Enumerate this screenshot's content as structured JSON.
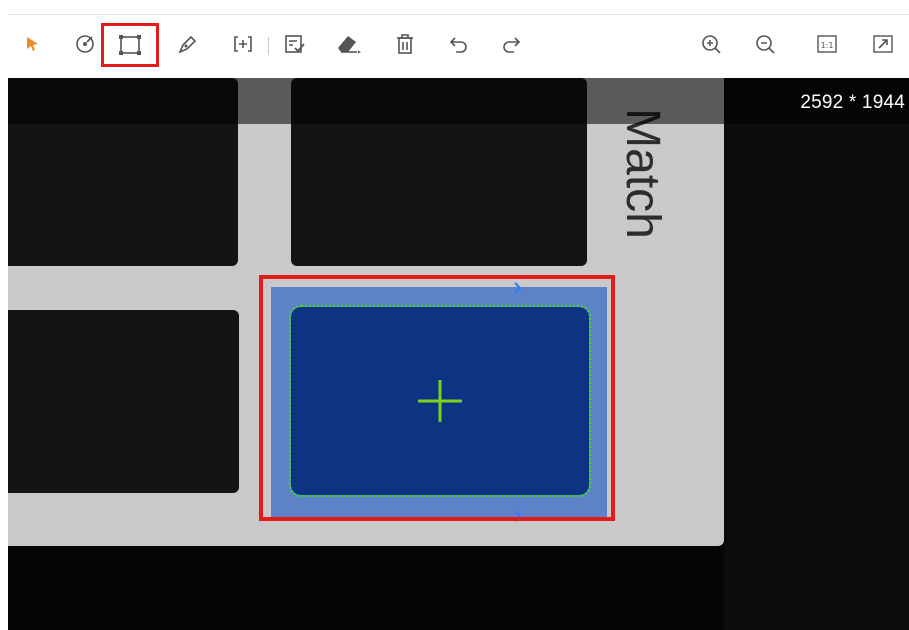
{
  "toolbar": {
    "tools": [
      {
        "name": "select-tool",
        "icon": "arrow-cursor-icon"
      },
      {
        "name": "circle-roi-tool",
        "icon": "circle-target-icon"
      },
      {
        "name": "rectangle-roi-tool",
        "icon": "rectangle-roi-icon",
        "active": true
      },
      {
        "name": "pen-tool",
        "icon": "pen-icon"
      },
      {
        "name": "add-region-tool",
        "icon": "bracket-plus-icon"
      },
      {
        "name": "apply-tool",
        "icon": "checklist-icon"
      },
      {
        "name": "eraser-tool",
        "icon": "eraser-icon"
      },
      {
        "name": "delete-tool",
        "icon": "trash-icon"
      },
      {
        "name": "undo-tool",
        "icon": "undo-icon"
      },
      {
        "name": "redo-tool",
        "icon": "redo-icon"
      },
      {
        "name": "zoom-in-tool",
        "icon": "zoom-in-icon"
      },
      {
        "name": "zoom-out-tool",
        "icon": "zoom-out-icon"
      },
      {
        "name": "actual-size-tool",
        "icon": "actual-size-icon",
        "label": "1:1"
      },
      {
        "name": "fit-window-tool",
        "icon": "fit-window-icon"
      }
    ]
  },
  "viewer": {
    "resolution": "2592 * 1944",
    "card_text": "Match"
  },
  "colors": {
    "active_highlight": "#e41b1b",
    "roi_fill": "#5d82c8",
    "roi_inner": "#0c3482",
    "contour": "#38e11c",
    "cursor_icon": "#f08a24"
  }
}
